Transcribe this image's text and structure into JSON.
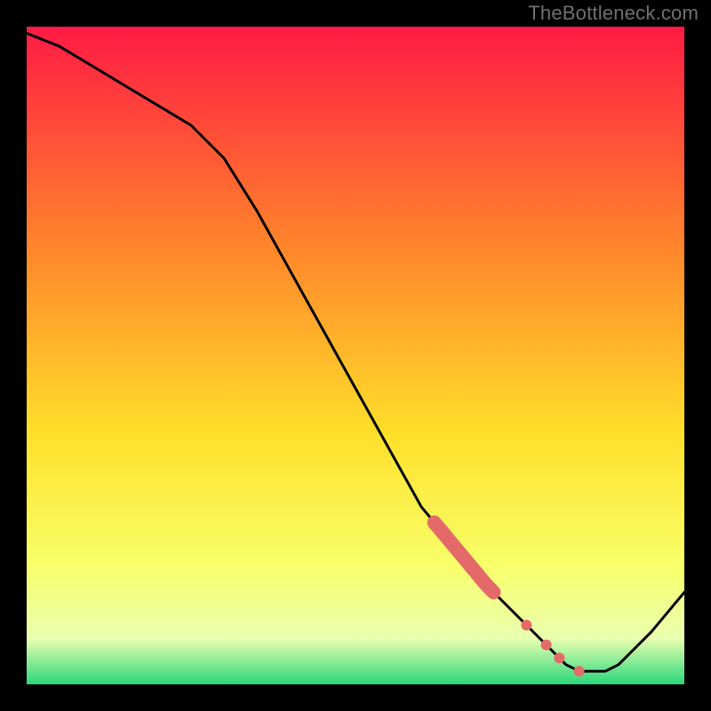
{
  "watermark": "TheBottleneck.com",
  "colors": {
    "background": "#000000",
    "top_gradient": "#ff1a44",
    "mid1_gradient": "#ff8a2a",
    "mid2_gradient": "#ffe02a",
    "mid3_gradient": "#f7ff6a",
    "band_pale": "#eaffb0",
    "band_green": "#2bd67b",
    "line": "#000000",
    "marker": "#e46a6a",
    "watermark": "#707070"
  },
  "chart_data": {
    "type": "line",
    "title": "",
    "xlabel": "",
    "ylabel": "",
    "xlim": [
      0,
      100
    ],
    "ylim": [
      0,
      100
    ],
    "x": [
      0,
      5,
      10,
      15,
      20,
      25,
      30,
      35,
      40,
      45,
      50,
      55,
      60,
      65,
      70,
      75,
      80,
      82,
      84,
      86,
      88,
      90,
      95,
      100
    ],
    "values": [
      99,
      97,
      94,
      91,
      88,
      85,
      80,
      72,
      63,
      54,
      45,
      36,
      27,
      21,
      15,
      10,
      5,
      3,
      2,
      2,
      2,
      3,
      8,
      14
    ],
    "highlight_band": {
      "x_start": 62,
      "x_end": 71
    },
    "highlight_dots_x": [
      76,
      79,
      81,
      84
    ]
  }
}
